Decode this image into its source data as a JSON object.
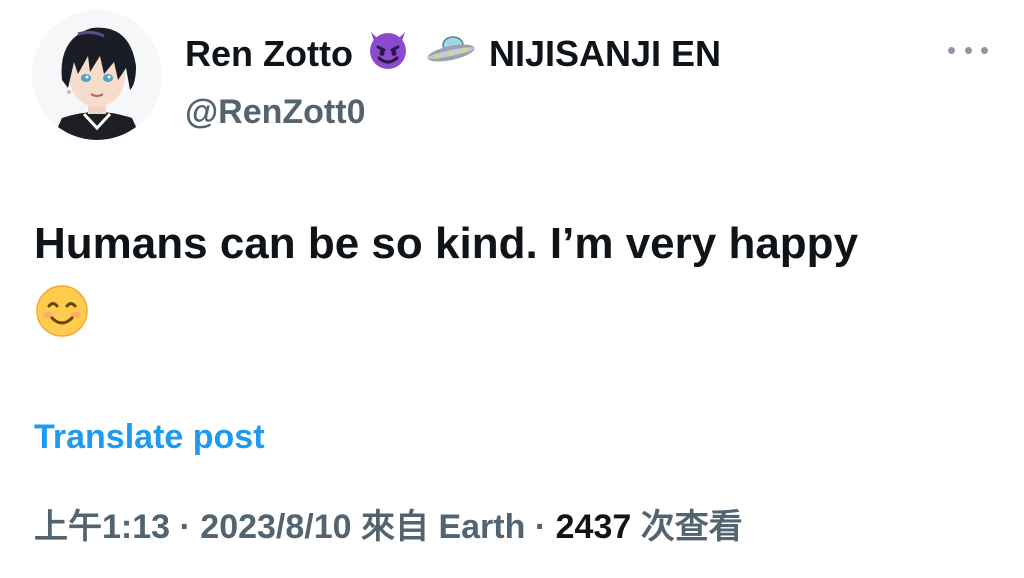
{
  "author": {
    "display_name": "Ren Zotto",
    "affiliation": "NIJISANJI EN",
    "handle": "@RenZott0",
    "avatar_icon": "anime-avatar",
    "name_emojis": [
      "smiling-devil-emoji",
      "flying-saucer-emoji"
    ]
  },
  "tweet": {
    "text": "Humans can be so kind. I’m very happy",
    "trailing_emoji": "smiling-face-emoji",
    "translate_label": "Translate post"
  },
  "meta": {
    "time": "上午1:13",
    "separator": "·",
    "date": "2023/8/10",
    "source_prefix": "來自",
    "source": "Earth",
    "views_count": "2437",
    "views_label": "次查看"
  },
  "colors": {
    "link": "#1d9bf0",
    "secondary": "#536471",
    "primary": "#0f1419"
  }
}
